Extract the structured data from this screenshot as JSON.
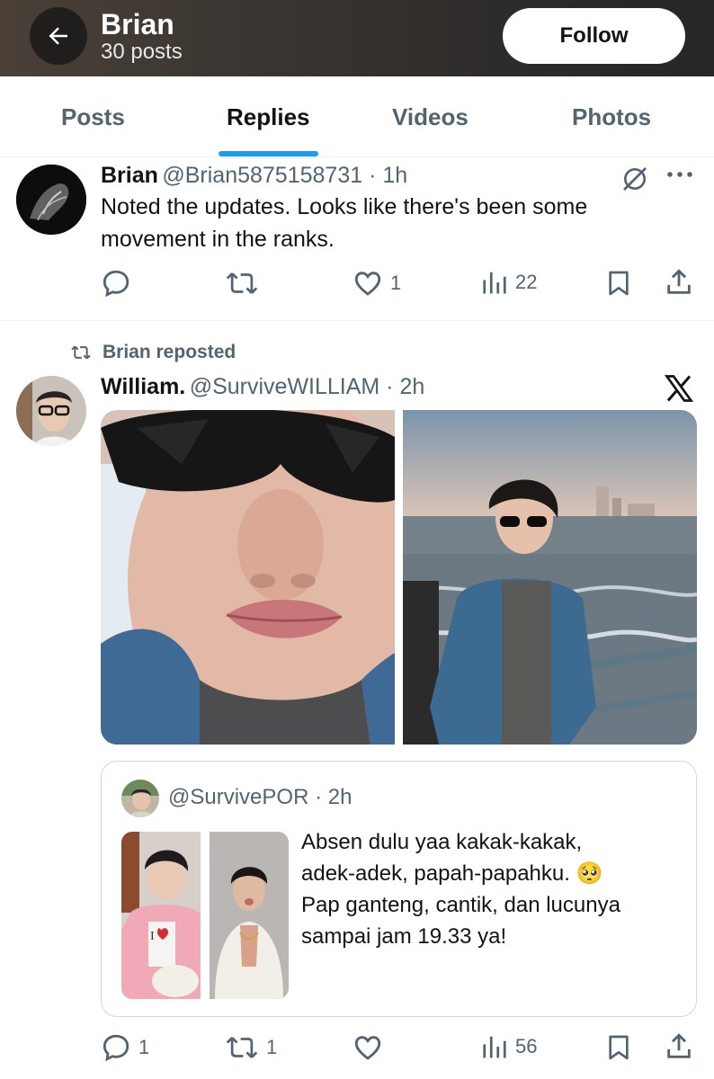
{
  "header": {
    "name": "Brian",
    "post_count": "30 posts",
    "follow_label": "Follow"
  },
  "tabs": [
    {
      "label": "Posts",
      "active": false
    },
    {
      "label": "Replies",
      "active": true
    },
    {
      "label": "Videos",
      "active": false
    },
    {
      "label": "Photos",
      "active": false
    }
  ],
  "post1": {
    "name": "Brian",
    "handle_time": "@Brian5875158731 · 1h",
    "text_line1": "Noted the updates. Looks like there's been some",
    "text_line2": "movement in the ranks.",
    "likes": "1",
    "views": "22"
  },
  "post2": {
    "repost_label": "Brian reposted",
    "name": "William.",
    "handle_time": "@SurviveWILLIAM · 2h",
    "quote": {
      "handle_time": "@SurvivePOR · 2h",
      "text_line1": "Absen dulu yaa kakak-kakak,",
      "text_line2": "adek-adek, papah-papahku. 🥺",
      "text_line3": "Pap ganteng, cantik, dan lucunya",
      "text_line4": "sampai jam 19.33 ya!"
    },
    "replies": "1",
    "reposts": "1",
    "views": "56"
  },
  "colors": {
    "accent": "#1d9bf0",
    "muted": "#536471",
    "text": "#0f1419"
  }
}
